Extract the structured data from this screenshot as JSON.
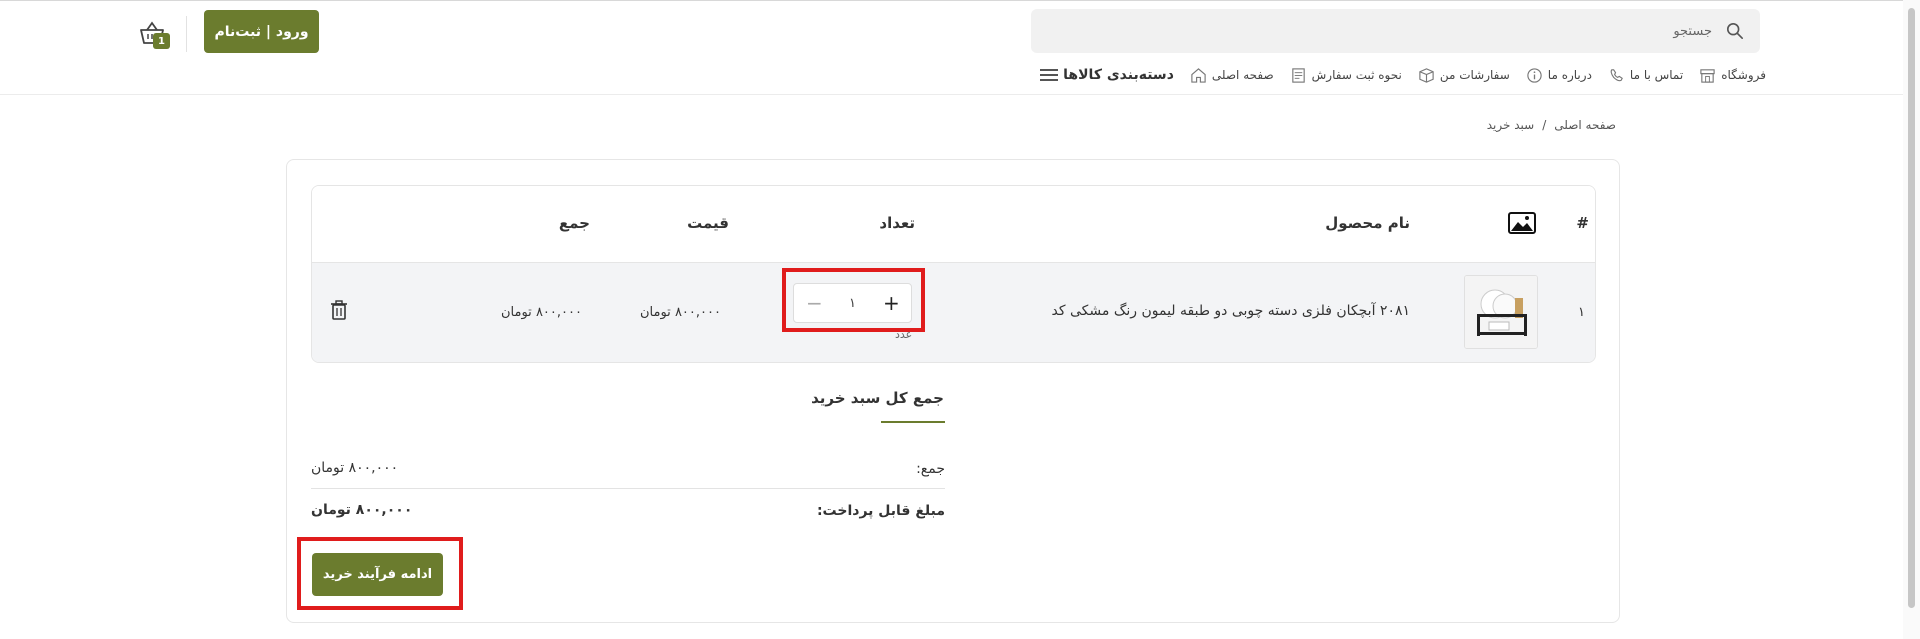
{
  "header": {
    "search_placeholder": "جستجو",
    "login_label": "ورود | ثبت‌نام",
    "cart_count": "1"
  },
  "nav": {
    "categories": "دسته‌بندی کالاها",
    "home": "صفحه اصلی",
    "how_to_order": "نحوه ثبت سفارش",
    "my_orders": "سفارشات من",
    "about": "درباره ما",
    "contact": "تماس با ما",
    "shop": "فروشگاه"
  },
  "breadcrumb": {
    "home": "صفحه اصلی",
    "separator": "/",
    "current": "سبد خرید"
  },
  "table": {
    "headers": {
      "index": "#",
      "name": "نام محصول",
      "quantity": "تعداد",
      "price": "قیمت",
      "total": "جمع"
    },
    "rows": [
      {
        "index": "۱",
        "name": "۲۰۸۱ آبچکان فلزی دسته چوبی دو طبقه لیمون رنگ مشکی کد",
        "quantity": "۱",
        "unit": "عدد",
        "price": "۸۰۰,۰۰۰ تومان",
        "total": "۸۰۰,۰۰۰ تومان"
      }
    ]
  },
  "totals": {
    "title": "جمع کل سبد خرید",
    "subtotal_label": "جمع:",
    "subtotal_value": "۸۰۰,۰۰۰ تومان",
    "payable_label": "مبلغ قابل پرداخت:",
    "payable_value": "۸۰۰,۰۰۰ تومان"
  },
  "checkout_label": "ادامه فرآیند خرید",
  "colors": {
    "accent": "#6b7c2e",
    "highlight": "#e01c1c"
  }
}
